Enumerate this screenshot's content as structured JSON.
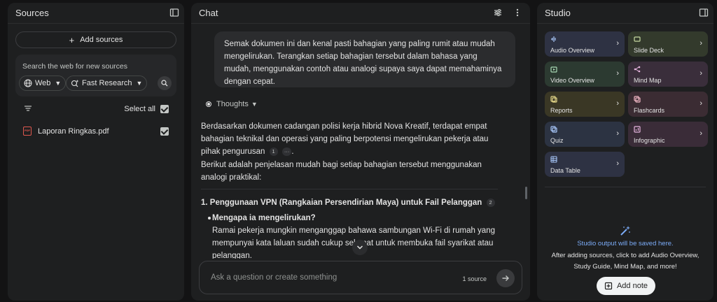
{
  "sources": {
    "title": "Sources",
    "add_sources": "Add sources",
    "search_label": "Search the web for new sources",
    "chip_web": "Web",
    "chip_research": "Fast Research",
    "select_all": "Select all",
    "items": [
      {
        "name": "Laporan Ringkas.pdf",
        "icon": "pdf-icon",
        "checked": true
      }
    ]
  },
  "chat": {
    "title": "Chat",
    "user_message": "Semak dokumen ini dan kenal pasti bahagian yang paling rumit atau mudah mengelirukan. Terangkan setiap bahagian tersebut dalam bahasa yang mudah, menggunakan contoh atau analogi supaya saya dapat memahaminya dengan cepat.",
    "thoughts_label": "Thoughts",
    "answer_p1": "Berdasarkan dokumen cadangan polisi kerja hibrid Nova Kreatif, terdapat empat bahagian teknikal dan operasi yang paling berpotensi mengelirukan pekerja atau pihak pengurusan",
    "cite_1": "1",
    "cite_more": "···",
    "answer_p1_end": ".",
    "answer_p2": "Berikut adalah penjelasan mudah bagi setiap bahagian tersebut menggunakan analogi praktikal:",
    "heading_1": "1. Penggunaan VPN (Rangkaian Persendirian Maya) untuk Fail Pelanggan",
    "cite_2": "2",
    "bullet_title": "Mengapa ia mengelirukan?",
    "bullet_text": "Ramai pekerja mungkin menganggap bahawa sambungan Wi-Fi di rumah yang mempunyai kata laluan sudah cukup selamat untuk membuka fail syarikat atau pelanggan.",
    "input_placeholder": "Ask a question or create something",
    "source_count": "1 source"
  },
  "studio": {
    "title": "Studio",
    "tiles": [
      {
        "label": "Audio Overview",
        "icon": "audio-waveform-icon",
        "bg": "#2e3243",
        "accent": "#a8c7fa"
      },
      {
        "label": "Slide Deck",
        "icon": "slides-icon",
        "bg": "#333a2c",
        "accent": "#c7dba3"
      },
      {
        "label": "Video Overview",
        "icon": "video-icon",
        "bg": "#2c3a31",
        "accent": "#a8dab5"
      },
      {
        "label": "Mind Map",
        "icon": "mind-map-icon",
        "bg": "#3a2e3b",
        "accent": "#e8b6e0"
      },
      {
        "label": "Reports",
        "icon": "reports-icon",
        "bg": "#3a3725",
        "accent": "#e6d98a"
      },
      {
        "label": "Flashcards",
        "icon": "flashcards-icon",
        "bg": "#3b2c33",
        "accent": "#f2b8c6"
      },
      {
        "label": "Quiz",
        "icon": "quiz-icon",
        "bg": "#2c3342",
        "accent": "#a8c7fa"
      },
      {
        "label": "Infographic",
        "icon": "infographic-icon",
        "bg": "#3a2c38",
        "accent": "#e8b6e0"
      },
      {
        "label": "Data Table",
        "icon": "table-icon",
        "bg": "#2e3243",
        "accent": "#a8c7fa"
      }
    ],
    "output_title": "Studio output will be saved here.",
    "output_desc": "After adding sources, click to add Audio Overview, Study Guide, Mind Map, and more!",
    "add_note": "Add note"
  }
}
